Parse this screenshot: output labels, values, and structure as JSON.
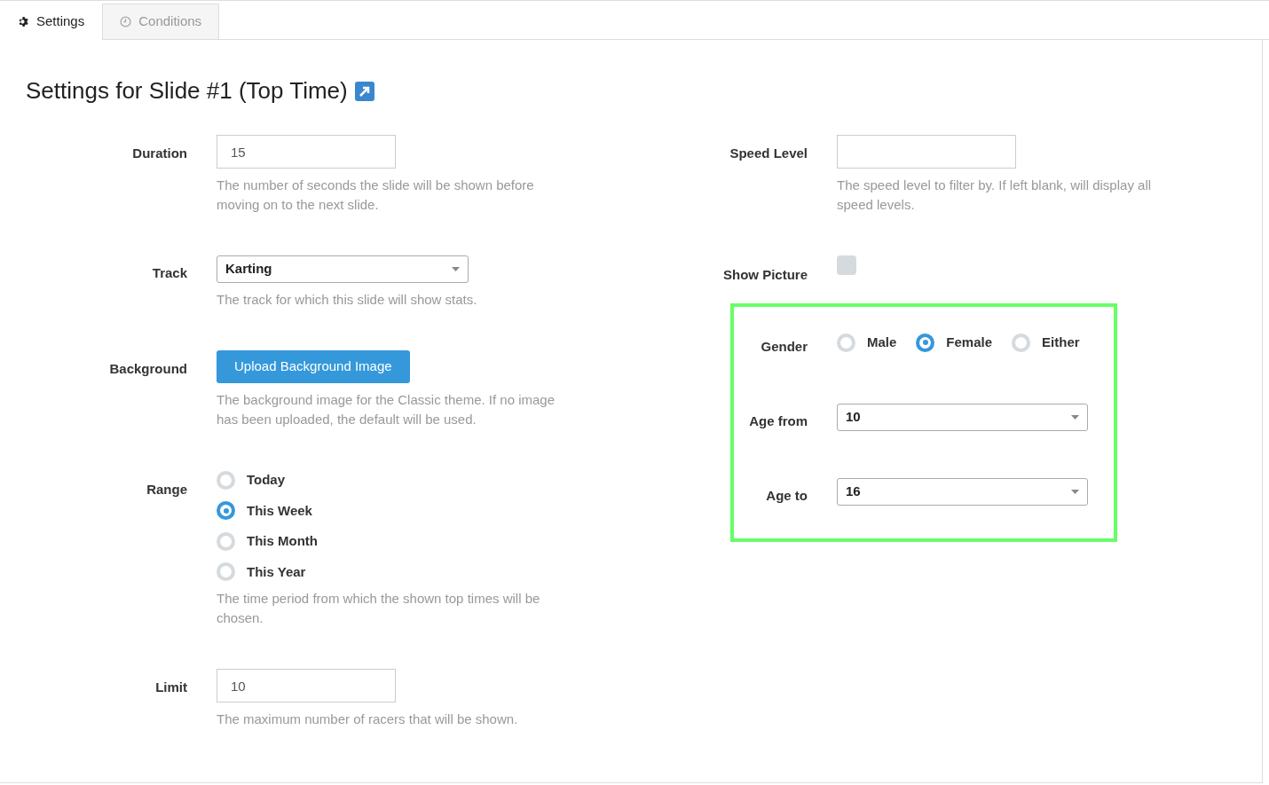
{
  "tabs": [
    {
      "label": "Settings",
      "selected": true
    },
    {
      "label": "Conditions",
      "selected": false
    }
  ],
  "title": "Settings for Slide #1 (Top Time)",
  "left_fields": [
    {
      "kind": "text",
      "label": "Duration",
      "value": "15",
      "help": "The number of seconds the slide will be shown before moving on to the next slide."
    },
    {
      "kind": "select",
      "label": "Track",
      "value": "Karting",
      "help": "The track for which this slide will show stats."
    },
    {
      "kind": "button",
      "label": "Background",
      "button": "Upload Background Image",
      "help": "The background image for the Classic theme. If no image has been uploaded, the default will be used."
    },
    {
      "kind": "radios",
      "label": "Range",
      "options": [
        {
          "label": "Today",
          "selected": false
        },
        {
          "label": "This Week",
          "selected": true
        },
        {
          "label": "This Month",
          "selected": false
        },
        {
          "label": "This Year",
          "selected": false
        }
      ],
      "help": "The time period from which the shown top times will be chosen."
    },
    {
      "kind": "text",
      "label": "Limit",
      "value": "10",
      "help": "The maximum number of racers that will be shown."
    }
  ],
  "right_fields": [
    {
      "kind": "text",
      "label": "Speed Level",
      "help": "The speed level to filter by. If left blank, will display all speed levels."
    },
    {
      "kind": "checkbox",
      "label": "Show Picture",
      "checked": false
    }
  ],
  "highlighted_fields": [
    {
      "kind": "inline_radios",
      "label": "Gender",
      "options": [
        {
          "label": "Male",
          "selected": false
        },
        {
          "label": "Female",
          "selected": true
        },
        {
          "label": "Either",
          "selected": false
        }
      ]
    },
    {
      "kind": "select",
      "label": "Age from",
      "value": "10"
    },
    {
      "kind": "select",
      "label": "Age to",
      "value": "16"
    }
  ]
}
